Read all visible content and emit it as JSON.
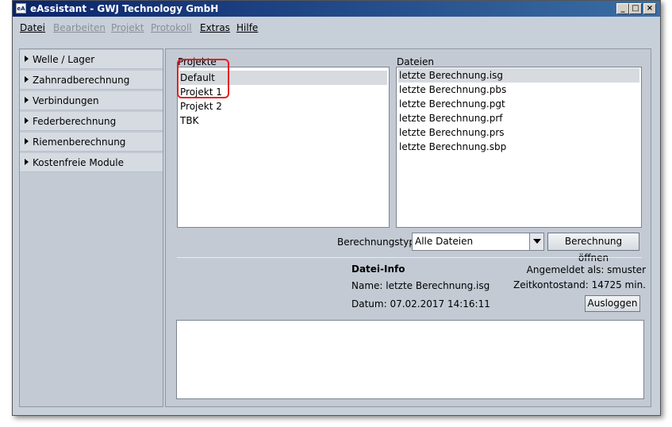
{
  "window": {
    "title": "eAssistant - GWJ Technology GmbH",
    "app_icon_text": "eA"
  },
  "titlebar_buttons": {
    "minimize": "_",
    "maximize": "□",
    "close": "×"
  },
  "menu": [
    {
      "label": "Datei",
      "enabled": true
    },
    {
      "label": "Bearbeiten",
      "enabled": false
    },
    {
      "label": "Projekt",
      "enabled": false
    },
    {
      "label": "Protokoll",
      "enabled": false
    },
    {
      "label": "Extras",
      "enabled": true
    },
    {
      "label": "Hilfe",
      "enabled": true
    }
  ],
  "sidebar": {
    "items": [
      {
        "label": "Welle / Lager"
      },
      {
        "label": "Zahnradberechnung"
      },
      {
        "label": "Verbindungen"
      },
      {
        "label": "Federberechnung"
      },
      {
        "label": "Riemenberechnung"
      },
      {
        "label": "Kostenfreie Module"
      }
    ]
  },
  "projects": {
    "label": "Projekte",
    "items": [
      "Default",
      "Projekt 1",
      "Projekt 2",
      "TBK"
    ],
    "selected_index": 0
  },
  "files": {
    "label": "Dateien",
    "items": [
      "letzte Berechnung.isg",
      "letzte Berechnung.pbs",
      "letzte Berechnung.pgt",
      "letzte Berechnung.prf",
      "letzte Berechnung.prs",
      "letzte Berechnung.sbp"
    ],
    "selected_index": 0
  },
  "calc_type": {
    "label": "Berechnungstyp",
    "value": "Alle Dateien",
    "open_button": "Berechnung öffnen"
  },
  "file_info": {
    "title": "Datei-Info",
    "name": "Name: letzte Berechnung.isg",
    "date": "Datum: 07.02.2017 14:16:11",
    "logged_in": "Angemeldet als: smuster",
    "time_account": "Zeitkontostand: 14725 min.",
    "logout_button": "Ausloggen"
  },
  "colors": {
    "title_gradient_start": "#0a246a",
    "title_gradient_end": "#3a6ea5",
    "annotation": "#e81d1d"
  }
}
